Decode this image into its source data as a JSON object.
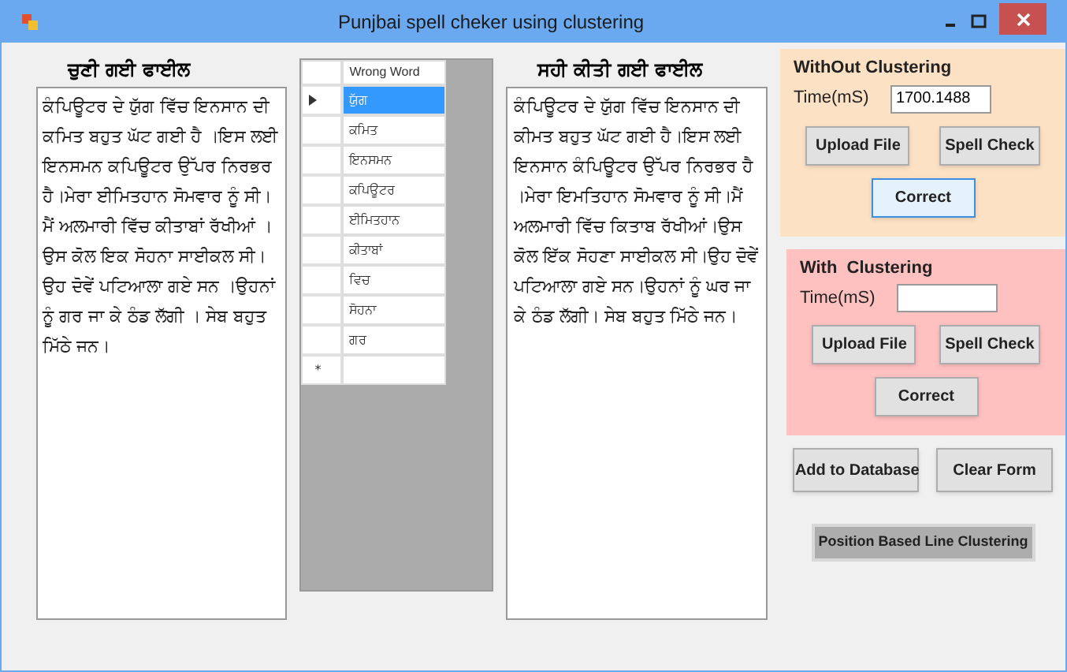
{
  "window": {
    "title": "Punjbai spell cheker using clustering"
  },
  "selected_file": {
    "heading": "ਚੁਣੀ ਗਈ ਫਾਈਲ",
    "text": "ਕੰਪਿਊਟਰ ਦੇ ਯੁੱਗ ਵਿੱਚ ਇਨਸਾਨ ਦੀ ਕਮਿਤ ਬਹੁਤ ਘੱਟ ਗਈ ਹੈ ।ਇਸ ਲਈ ਇਨਸਮਨ ਕਪਿਊਟਰ ਉੱਪਰ ਨਿਰਭਰ ਹੈ।ਮੇਰਾ ਈਮਿਤਹਾਨ ਸੋਮਵਾਰ ਨੂੰ ਸੀ।ਮੈਂ ਅਲਮਾਰੀ ਵਿੱਚ ਕੀਤਾਬਾਂ ਰੱਖੀਆਂ ।ਉਸ ਕੋਲ ਇਕ ਸੋਹਨਾ ਸਾਈਕਲ ਸੀ।ਉਹ ਦੋਵੇਂ ਪਟਿਆਲਾ ਗਏ ਸਨ ।ਉਹਨਾਂ ਨੂੰ ਗਰ ਜਾ ਕੇ ਠੰਡ ਲੱਗੀ । ਸੇਬ ਬਹੁਤ ਮਿੱਠੇ ਜਨ।"
  },
  "grid": {
    "columns": [
      "Wrong Word"
    ],
    "new_row_marker": "*",
    "rows": [
      {
        "word": "ਯੁੱਗ",
        "selected": true
      },
      {
        "word": "ਕਮਿਤ",
        "selected": false
      },
      {
        "word": "ਇਨਸਮਨ",
        "selected": false
      },
      {
        "word": "ਕਪਿਊਟਰ",
        "selected": false
      },
      {
        "word": "ਈਮਿਤਹਾਨ",
        "selected": false
      },
      {
        "word": "ਕੀਤਾਬਾਂ",
        "selected": false
      },
      {
        "word": "ਵਿਚ",
        "selected": false
      },
      {
        "word": "ਸੋਹਨਾ",
        "selected": false
      },
      {
        "word": "ਗਰ",
        "selected": false
      }
    ]
  },
  "corrected_file": {
    "heading": "ਸਹੀ ਕੀਤੀ ਗਈ ਫਾਈਲ",
    "text": "ਕੰਪਿਊਟਰ ਦੇ ਯੁੱਗ ਵਿੱਚ ਇਨਸਾਨ ਦੀ ਕੀਮਤ ਬਹੁਤ ਘੱਟ ਗਈ ਹੈ।ਇਸ ਲਈ ਇਨਸਾਨ ਕੰਪਿਊਟਰ ਉੱਪਰ ਨਿਰਭਰ ਹੈ ।ਮੇਰਾ ਇਮਤਿਹਾਨ ਸੋਮਵਾਰ ਨੂੰ ਸੀ।ਮੈਂ ਅਲਮਾਰੀ ਵਿੱਚ ਕਿਤਾਬ ਰੱਖੀਆਂ।ਉਸ ਕੋਲ ਇੱਕ ਸੋਹਣਾ ਸਾਈਕਲ ਸੀ।ਉਹ ਦੋਵੇਂ ਪਟਿਆਲਾ ਗਏ ਸਨ।ਉਹਨਾਂ ਨੂੰ ਘਰ ਜਾ ਕੇ ਠੰਡ ਲੱਗੀ। ਸੇਬ ਬਹੁਤ ਮਿੱਠੇ ਜਨ।"
  },
  "groups": [
    {
      "title": "WithOut Clustering",
      "color": "#fde1c4",
      "time_label": "Time(mS)",
      "time_value": "1700.1488",
      "upload": "Upload File",
      "spell_check": "Spell Check",
      "correct": "Correct",
      "correct_focused": true
    },
    {
      "title": "With  Clustering",
      "color": "#ffc0c0",
      "time_label": "Time(mS)",
      "upload": "Upload File",
      "spell_check": "Spell Check",
      "correct": "Correct",
      "correct_focused": false
    }
  ],
  "buttons": [
    "Add to Database",
    "Clear Form"
  ],
  "line_clustering_button": "Position Based Line Clustering"
}
